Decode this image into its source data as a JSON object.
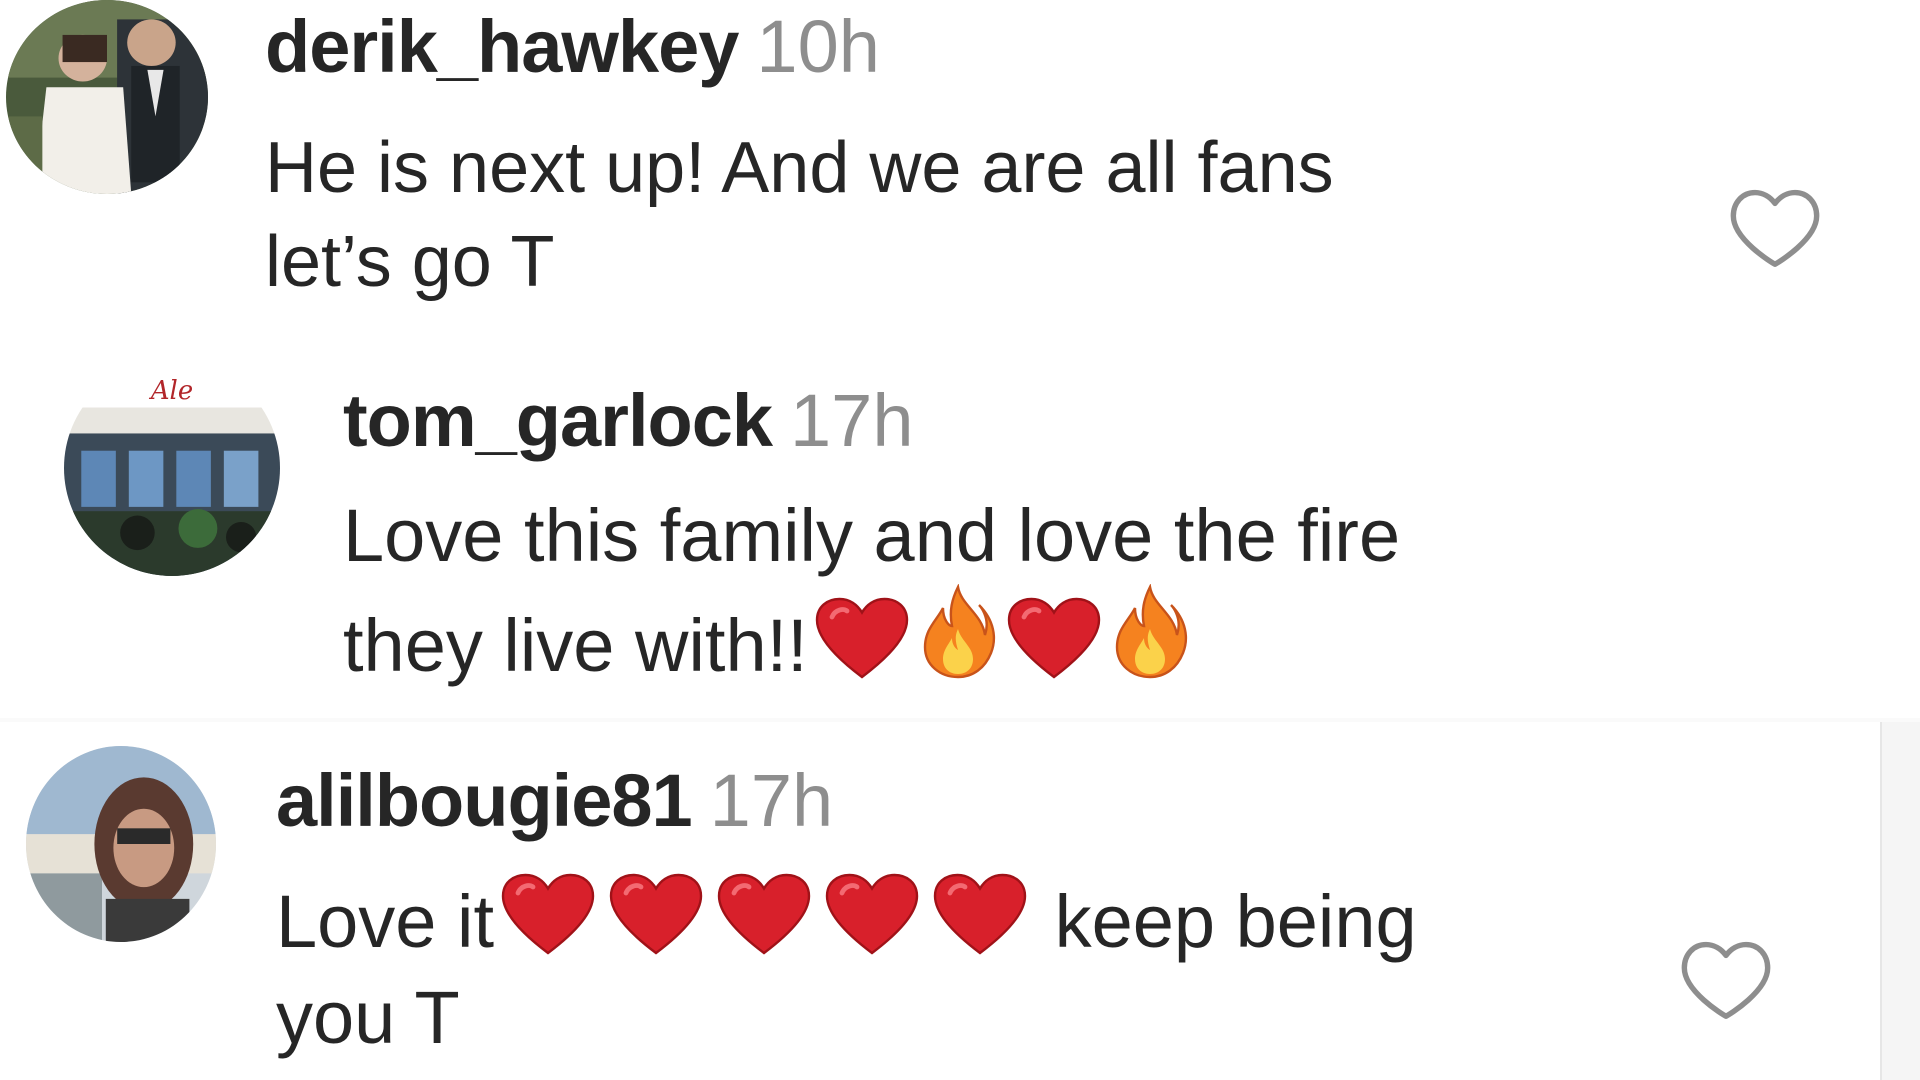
{
  "comments": [
    {
      "username": "derik_hawkey",
      "time": "10h",
      "line1": "He is next up! And we are all fans",
      "line2": "let’s go T",
      "avatar_icon": "wedding-couple-avatar",
      "like_icon": "heart-outline-icon"
    },
    {
      "username": "tom_garlock",
      "time": "17h",
      "line1": "Love this family and love the fire",
      "line2": "they live with!!",
      "line2_emojis": [
        "red-heart",
        "fire",
        "red-heart",
        "fire"
      ],
      "avatar_icon": "storefront-avatar"
    },
    {
      "username": "alilbougie81",
      "time": "17h",
      "line1_prefix": "Love it",
      "line1_emojis": [
        "red-heart",
        "red-heart",
        "red-heart",
        "red-heart",
        "red-heart"
      ],
      "line1_suffix": " keep being",
      "line2": "you T",
      "avatar_icon": "selfie-avatar",
      "like_icon": "heart-outline-icon"
    }
  ],
  "colors": {
    "text": "#262626",
    "timestamp": "#8e8e8e",
    "heart_emoji": "#d8202b",
    "fire_emoji": "#f5821f",
    "like_outline": "#8e8e8e"
  }
}
